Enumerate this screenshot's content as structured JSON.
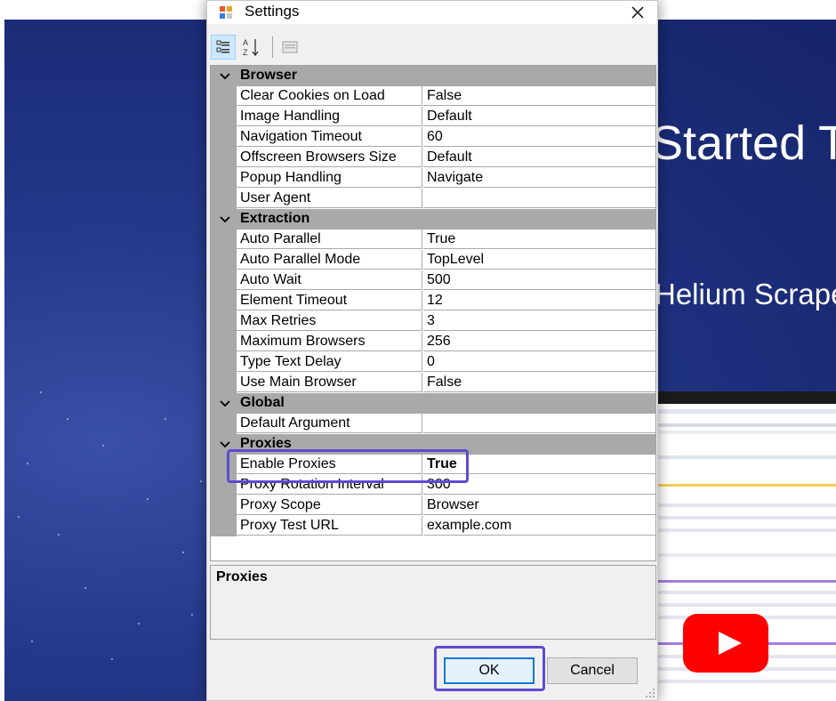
{
  "background": {
    "hero_title": "Started T",
    "hero_subtitle": "Helium Scrape",
    "video_play_icon": "play-icon"
  },
  "dialog": {
    "title": "Settings",
    "toolbar": {
      "categorized_icon": "categorized-view-icon",
      "alphabetical_icon": "alphabetical-sort-icon",
      "property_pages_icon": "property-pages-icon"
    },
    "categories": [
      {
        "name": "Browser",
        "properties": [
          {
            "name": "Clear Cookies on Load",
            "value": "False"
          },
          {
            "name": "Image Handling",
            "value": "Default"
          },
          {
            "name": "Navigation Timeout",
            "value": "60"
          },
          {
            "name": "Offscreen Browsers Size",
            "value": "Default"
          },
          {
            "name": "Popup Handling",
            "value": "Navigate"
          },
          {
            "name": "User Agent",
            "value": ""
          }
        ]
      },
      {
        "name": "Extraction",
        "properties": [
          {
            "name": "Auto Parallel",
            "value": "True"
          },
          {
            "name": "Auto Parallel Mode",
            "value": "TopLevel"
          },
          {
            "name": "Auto Wait",
            "value": "500"
          },
          {
            "name": "Element Timeout",
            "value": "12"
          },
          {
            "name": "Max Retries",
            "value": "3"
          },
          {
            "name": "Maximum Browsers",
            "value": "256"
          },
          {
            "name": "Type Text Delay",
            "value": "0"
          },
          {
            "name": "Use Main Browser",
            "value": "False"
          }
        ]
      },
      {
        "name": "Global",
        "properties": [
          {
            "name": "Default Argument",
            "value": ""
          }
        ]
      },
      {
        "name": "Proxies",
        "properties": [
          {
            "name": "Enable Proxies",
            "value": "True"
          },
          {
            "name": "Proxy Rotation Interval",
            "value": "300"
          },
          {
            "name": "Proxy Scope",
            "value": "Browser"
          },
          {
            "name": "Proxy Test URL",
            "value": "example.com"
          }
        ]
      }
    ],
    "help": {
      "title": "Proxies"
    },
    "buttons": {
      "ok": "OK",
      "cancel": "Cancel"
    }
  }
}
